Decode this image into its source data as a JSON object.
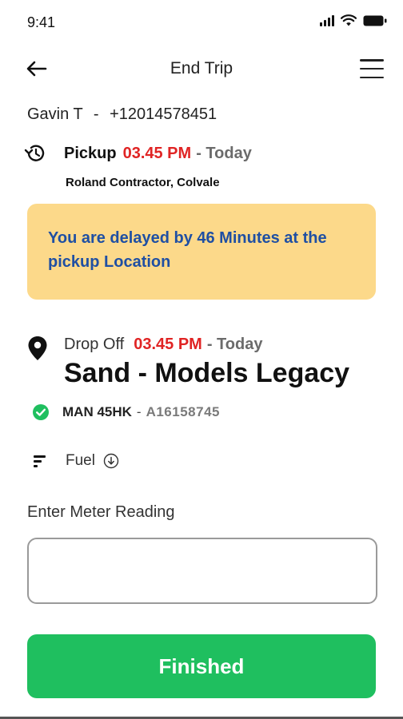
{
  "status_bar": {
    "time": "9:41",
    "icons": [
      "signal-icon",
      "wifi-icon",
      "battery-icon"
    ]
  },
  "header": {
    "title": "End Trip",
    "back_icon": "arrow-left-icon",
    "menu_icon": "hamburger-menu-icon"
  },
  "contact": {
    "name": "Gavin T",
    "separator": "-",
    "phone": "+12014578451"
  },
  "pickup": {
    "icon": "history-clock-icon",
    "label": "Pickup",
    "time": "03.45 PM",
    "day": "- Today",
    "address": "Roland Contractor, Colvale"
  },
  "alert": {
    "message": "You are delayed by 46 Minutes at the pickup Location"
  },
  "dropoff": {
    "icon": "location-pin-icon",
    "label": "Drop Off",
    "time": "03.45 PM",
    "day": "- Today",
    "destination": "Sand - Models Legacy"
  },
  "vehicle": {
    "icon": "check-circle-icon",
    "plate": "MAN 45HK",
    "separator": "-",
    "id": "A16158745"
  },
  "fuel": {
    "icon": "fuel-bars-icon",
    "label": "Fuel",
    "dropdown_icon": "chevron-down-circle-icon"
  },
  "meter": {
    "label": "Enter Meter Reading",
    "value": "",
    "placeholder": ""
  },
  "actions": {
    "finish_label": "Finished"
  },
  "colors": {
    "accent_green": "#1fbf5f",
    "time_red": "#e02424",
    "alert_bg": "#fcd98a",
    "alert_text": "#1f4fa3"
  }
}
